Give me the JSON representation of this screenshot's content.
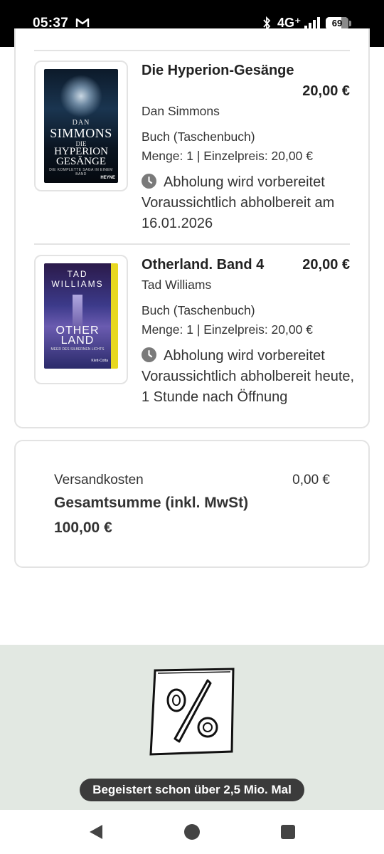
{
  "status_bar": {
    "time": "05:37",
    "network": "4G⁺",
    "battery": "69",
    "battery_level": 0.69
  },
  "items": [
    {
      "title": "Die Hyperion-Gesänge",
      "price": "20,00 €",
      "author": "Dan Simmons",
      "format": "Buch (Taschenbuch)",
      "quantity_line": "Menge: 1 | Einzelpreis: 20,00 €",
      "status_heading": "Abholung wird vorbereitet",
      "status_detail": "Voraussichtlich abholbereit am 16.01.2026",
      "cover": {
        "author_small": "DAN",
        "author": "SIMMONS",
        "title_prefix": "DIE",
        "title_line1": "HYPERION",
        "title_line2": "GESÄNGE",
        "tagline": "DIE KOMPLETTE SAGA IN EINEM BAND",
        "publisher": "HEYNE"
      }
    },
    {
      "title": "Otherland. Band 4",
      "price": "20,00 €",
      "author": "Tad Williams",
      "format": "Buch (Taschenbuch)",
      "quantity_line": "Menge: 1 | Einzelpreis: 20,00 €",
      "status_heading": "Abholung wird vorbereitet",
      "status_detail": "Voraussichtlich abholbereit heute, 1 Stunde nach Öffnung",
      "cover": {
        "author_line1": "TAD",
        "author_line2": "WILLIAMS",
        "title_line1": "OTHER",
        "title_line2": "LAND",
        "subtitle": "MEER DES SILBERNEN LICHTS",
        "publisher": "Klett-Cotta"
      }
    }
  ],
  "totals": {
    "shipping_label": "Versandkosten",
    "shipping_value": "0,00 €",
    "total_label": "Gesamtsumme (inkl. MwSt)",
    "total_value": "100,00 €"
  },
  "promo": {
    "icon": "percent-icon",
    "badge": "Begeistert schon über 2,5 Mio. Mal"
  },
  "nav": {
    "back_icon": "back-triangle-icon",
    "home_icon": "home-circle-icon",
    "recents_icon": "recents-square-icon"
  }
}
